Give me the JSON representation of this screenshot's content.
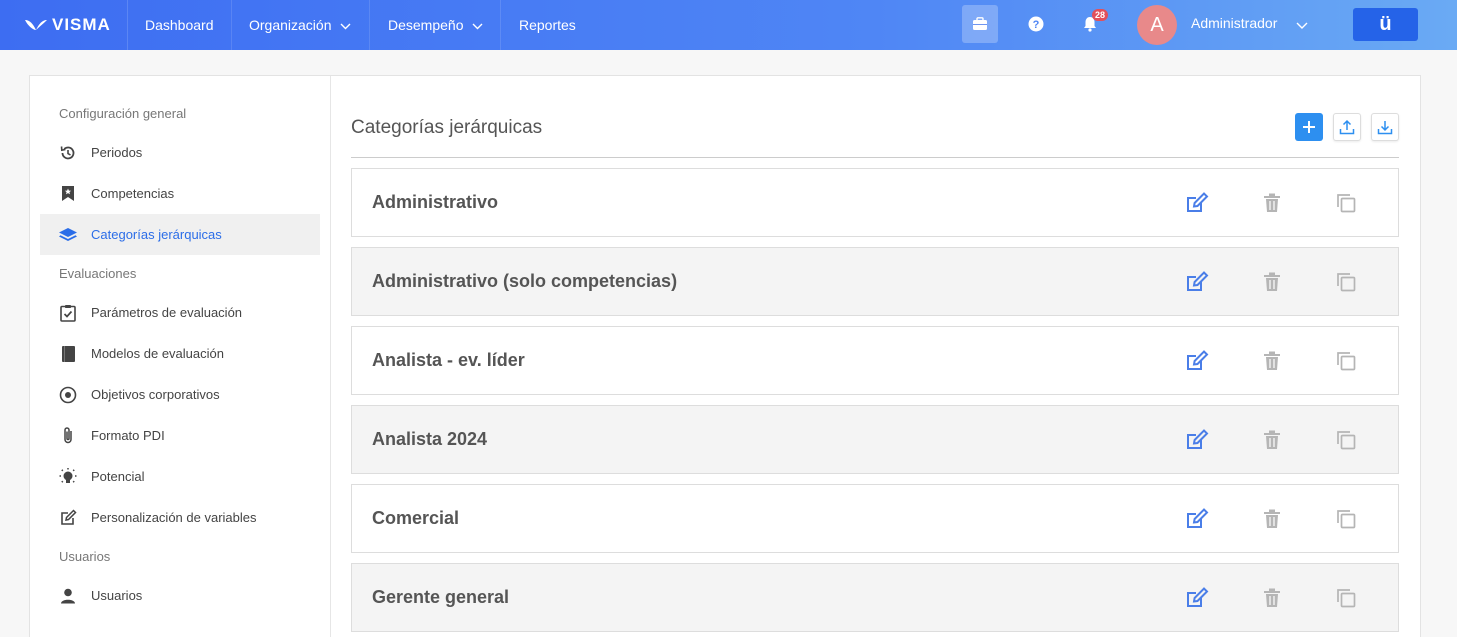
{
  "topbar": {
    "logo_text": "VISMA",
    "nav": [
      {
        "label": "Dashboard"
      },
      {
        "label": "Organización"
      },
      {
        "label": "Desempeño"
      },
      {
        "label": "Reportes"
      }
    ],
    "notifications_count": "28",
    "avatar_letter": "A",
    "user_name": "Administrador",
    "brand_button": "ü"
  },
  "sidebar": {
    "sections": [
      {
        "title": "Configuración general"
      },
      {
        "title": "Evaluaciones"
      },
      {
        "title": "Usuarios"
      }
    ],
    "items": [
      {
        "label": "Periodos",
        "icon": "history-icon"
      },
      {
        "label": "Competencias",
        "icon": "bookmark-star-icon"
      },
      {
        "label": "Categorías jerárquicas",
        "icon": "layers-icon"
      },
      {
        "label": "Parámetros de evaluación",
        "icon": "clipboard-check-icon"
      },
      {
        "label": "Modelos de evaluación",
        "icon": "book-icon"
      },
      {
        "label": "Objetivos corporativos",
        "icon": "target-icon"
      },
      {
        "label": "Formato PDI",
        "icon": "paperclip-icon"
      },
      {
        "label": "Potencial",
        "icon": "lightbulb-icon"
      },
      {
        "label": "Personalización de variables",
        "icon": "edit-icon"
      },
      {
        "label": "Usuarios",
        "icon": "user-icon"
      }
    ]
  },
  "main": {
    "title": "Categorías jerárquicas",
    "rows": [
      {
        "label": "Administrativo"
      },
      {
        "label": "Administrativo (solo competencias)"
      },
      {
        "label": "Analista - ev. líder"
      },
      {
        "label": "Analista 2024"
      },
      {
        "label": "Comercial"
      },
      {
        "label": "Gerente general"
      }
    ]
  },
  "colors": {
    "accent": "#2b6de8",
    "topbar_start": "#3d6df2",
    "topbar_end": "#6aaaf4",
    "edit_icon": "#4a7ee8",
    "disabled_icon": "#b5b5b5"
  }
}
